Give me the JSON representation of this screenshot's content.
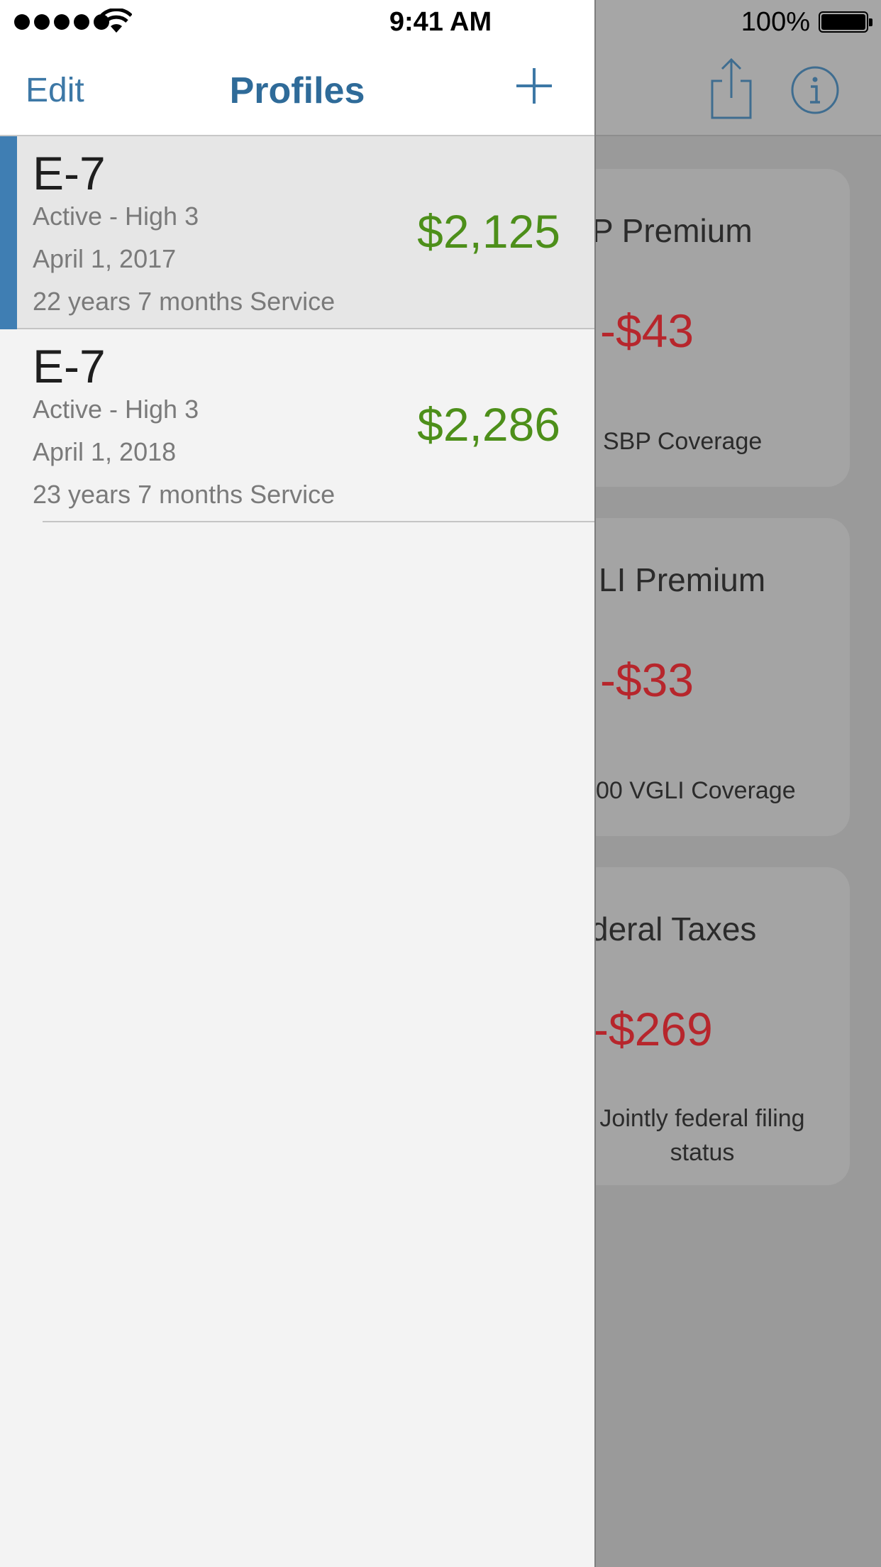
{
  "status_bar": {
    "time": "9:41 AM",
    "battery": "100%"
  },
  "drawer": {
    "edit_label": "Edit",
    "title": "Profiles",
    "add_icon": "plus-icon",
    "profiles": [
      {
        "rank": "E-7",
        "status": "Active - High 3",
        "date": "April 1, 2017",
        "service": "22 years 7 months Service",
        "amount": "$2,125",
        "selected": true
      },
      {
        "rank": "E-7",
        "status": "Active - High 3",
        "date": "April 1, 2018",
        "service": "23 years 7 months Service",
        "amount": "$2,286",
        "selected": false
      }
    ]
  },
  "main": {
    "nav_icons": [
      "share-icon",
      "info-icon"
    ],
    "cards": [
      {
        "title": "P Premium",
        "amount": "-$43",
        "note": "SBP Coverage"
      },
      {
        "title": "LI Premium",
        "amount": "-$33",
        "note": "00 VGLI Coverage"
      },
      {
        "title": "deral Taxes",
        "amount": "-$269",
        "note": "Jointly federal filing status"
      }
    ]
  },
  "colors": {
    "accent": "#3d78a6",
    "positive": "#4d8f1a",
    "negative": "#b7262c",
    "selection_bar": "#3f7eb3"
  }
}
